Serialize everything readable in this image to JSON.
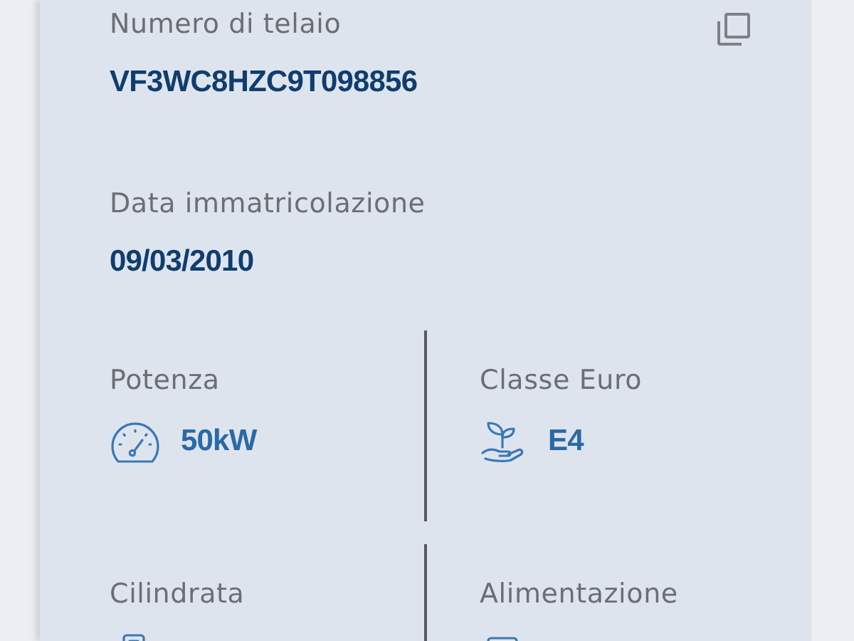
{
  "fields": [
    {
      "label": "Numero di telaio",
      "value": "VF3WC8HZC9T098856",
      "copyable": true
    },
    {
      "label": "Data immatricolazione",
      "value": "09/03/2010",
      "copyable": false
    }
  ],
  "specs": [
    {
      "label": "Potenza",
      "value": "50kW"
    },
    {
      "label": "Classe Euro",
      "value": "E4"
    },
    {
      "label": "Cilindrata"
    },
    {
      "label": "Alimentazione"
    }
  ]
}
